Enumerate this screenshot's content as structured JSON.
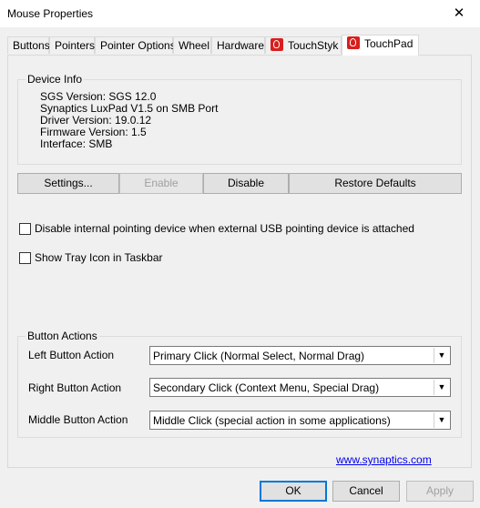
{
  "window": {
    "title": "Mouse Properties",
    "close_glyph": "✕"
  },
  "tabs": [
    {
      "label": "Buttons",
      "icon": ""
    },
    {
      "label": "Pointers",
      "icon": ""
    },
    {
      "label": "Pointer Options",
      "icon": ""
    },
    {
      "label": "Wheel",
      "icon": ""
    },
    {
      "label": "Hardware",
      "icon": ""
    },
    {
      "label": "TouchStyk",
      "icon": "synaptics-icon"
    },
    {
      "label": "TouchPad",
      "icon": "synaptics-icon",
      "active": true
    }
  ],
  "device_info": {
    "heading": "Device Info",
    "lines": [
      "SGS Version: SGS 12.0",
      "Synaptics LuxPad V1.5 on SMB Port",
      "Driver Version: 19.0.12",
      "Firmware Version: 1.5",
      "Interface: SMB"
    ]
  },
  "device_buttons": {
    "settings": "Settings...",
    "enable": "Enable",
    "disable": "Disable",
    "restore": "Restore Defaults"
  },
  "options": {
    "disable_internal": {
      "label": "Disable internal pointing device when external USB pointing device is attached",
      "checked": false
    },
    "tray_icon": {
      "label": "Show Tray Icon in Taskbar",
      "checked": false
    }
  },
  "button_actions": {
    "heading": "Button Actions",
    "left": {
      "label": "Left Button Action",
      "value": "Primary Click (Normal Select, Normal Drag)"
    },
    "right": {
      "label": "Right Button Action",
      "value": "Secondary Click (Context Menu, Special Drag)"
    },
    "middle": {
      "label": "Middle Button Action",
      "value": "Middle Click (special action in some applications)"
    }
  },
  "link": {
    "text": "www.synaptics.com"
  },
  "footer": {
    "ok": "OK",
    "cancel": "Cancel",
    "apply": "Apply"
  },
  "colors": {
    "accent": "#0078d7",
    "synaptics_red": "#d81e1e",
    "link": "#0000ee"
  }
}
